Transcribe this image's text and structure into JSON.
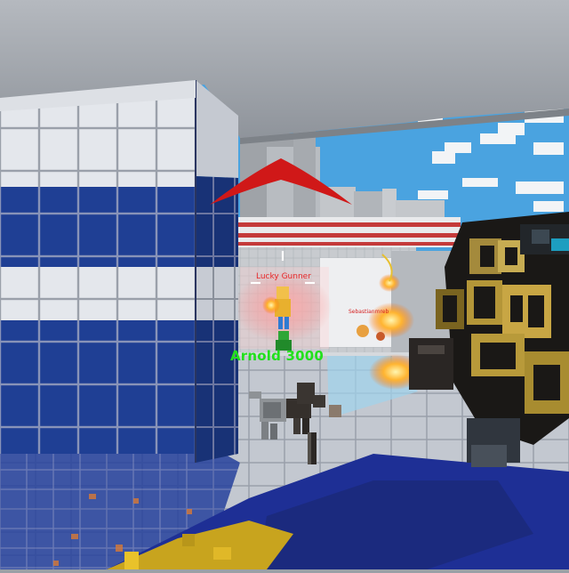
{
  "hud": {
    "enemy_name": "Lucky Gunner",
    "far_enemy_name": "Sebastianmreb",
    "ally_name_label": "Arnold 3000"
  },
  "icons": {
    "direction_indicator": "chevron-up-icon",
    "crosshair": "crosshair-icon"
  },
  "colors": {
    "indicator": "#d01818",
    "enemy_name": "#e8282a",
    "ally_name": "#22e01c",
    "sky": "#4aa3e0",
    "tile_blue": "#1f3f94",
    "tile_white": "#e6e9ee"
  }
}
